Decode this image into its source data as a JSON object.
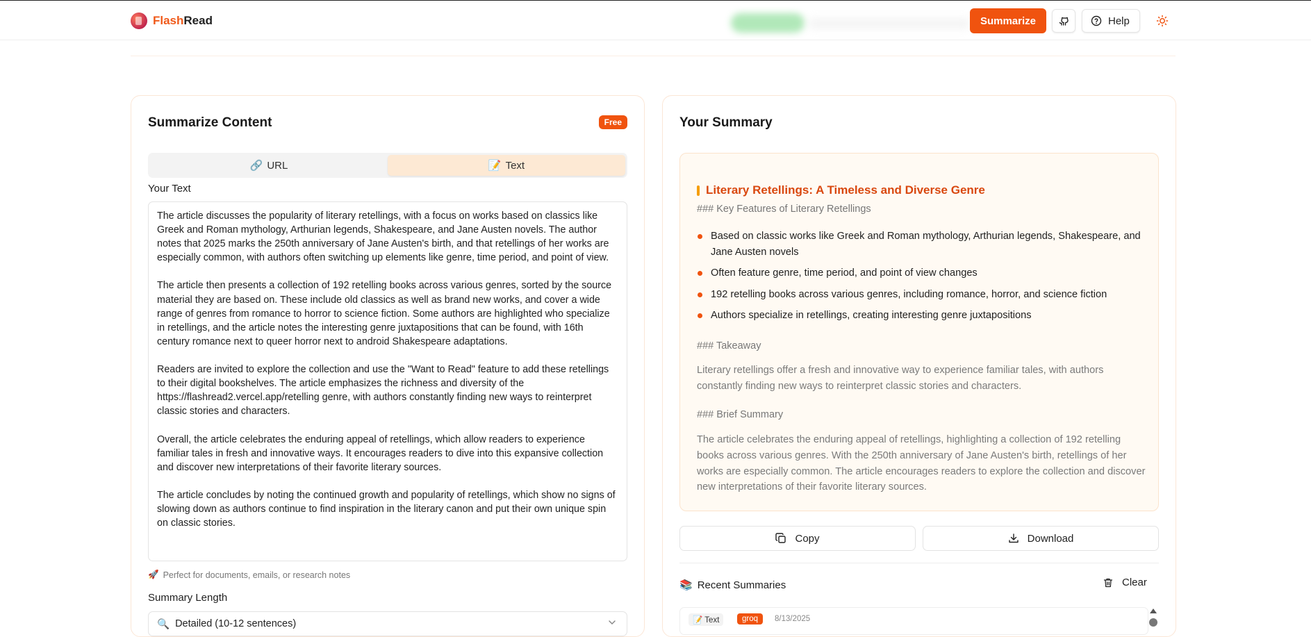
{
  "header": {
    "brand_prefix": "Flash",
    "brand_suffix": "Read",
    "summarize_label": "Summarize",
    "help_label": "Help"
  },
  "input_panel": {
    "title": "Summarize Content",
    "badge": "Free",
    "tabs": [
      {
        "icon": "🔗",
        "label": "URL",
        "active": false
      },
      {
        "icon": "📝",
        "label": "Text",
        "active": true
      }
    ],
    "text_label": "Your Text",
    "text_value": "The article discusses the popularity of literary retellings, with a focus on works based on classics like Greek and Roman mythology, Arthurian legends, Shakespeare, and Jane Austen novels. The author notes that 2025 marks the 250th anniversary of Jane Austen's birth, and that retellings of her works are especially common, with authors often switching up elements like genre, time period, and point of view.\n\nThe article then presents a collection of 192 retelling books across various genres, sorted by the source material they are based on. These include old classics as well as brand new works, and cover a wide range of genres from romance to horror to science fiction. Some authors are highlighted who specialize in retellings, and the article notes the interesting genre juxtapositions that can be found, with 16th century romance next to queer horror next to android Shakespeare adaptations.\n\nReaders are invited to explore the collection and use the \"Want to Read\" feature to add these retellings to their digital bookshelves. The article emphasizes the richness and diversity of the https://flashread2.vercel.app/retelling genre, with authors constantly finding new ways to reinterpret classic stories and characters.\n\nOverall, the article celebrates the enduring appeal of retellings, which allow readers to experience familiar tales in fresh and innovative ways. It encourages readers to dive into this expansive collection and discover new interpretations of their favorite literary sources.\n\nThe article concludes by noting the continued growth and popularity of retellings, which show no signs of slowing down as authors continue to find inspiration in the literary canon and put their own unique spin on classic stories.",
    "hint_icon": "🚀",
    "hint": "Perfect for documents, emails, or research notes",
    "length_label": "Summary Length",
    "length_icon": "🔍",
    "length_value": "Detailed (10-12 sentences)"
  },
  "summary_panel": {
    "title": "Your Summary",
    "heading": "Literary Retellings: A Timeless and Diverse Genre",
    "features_heading": "### Key Features of Literary Retellings",
    "bullets": [
      "Based on classic works like Greek and Roman mythology, Arthurian legends, Shakespeare, and Jane Austen novels",
      "Often feature genre, time period, and point of view changes",
      "192 retelling books across various genres, including romance, horror, and science fiction",
      "Authors specialize in retellings, creating interesting genre juxtapositions"
    ],
    "takeaway_heading": "### Takeaway",
    "takeaway": "Literary retellings offer a fresh and innovative way to experience familiar tales, with authors constantly finding new ways to reinterpret classic stories and characters.",
    "brief_heading": "### Brief Summary",
    "brief": "The article celebrates the enduring appeal of retellings, highlighting a collection of 192 retelling books across various genres. With the 250th anniversary of Jane Austen's birth, retellings of her works are especially common. The article encourages readers to explore the collection and discover new interpretations of their favorite literary sources.",
    "copy_label": "Copy",
    "download_label": "Download",
    "recent_icon": "📚",
    "recent_label": "Recent Summaries",
    "clear_label": "Clear",
    "recent_items": [
      {
        "tag": "📝 Text",
        "badge": "groq",
        "date": "8/13/2025"
      }
    ]
  },
  "colors": {
    "accent": "#f0530f",
    "heading_accent": "#d9480f",
    "summary_bg": "#fffaf3",
    "active_tab_bg": "#fde9d4"
  }
}
